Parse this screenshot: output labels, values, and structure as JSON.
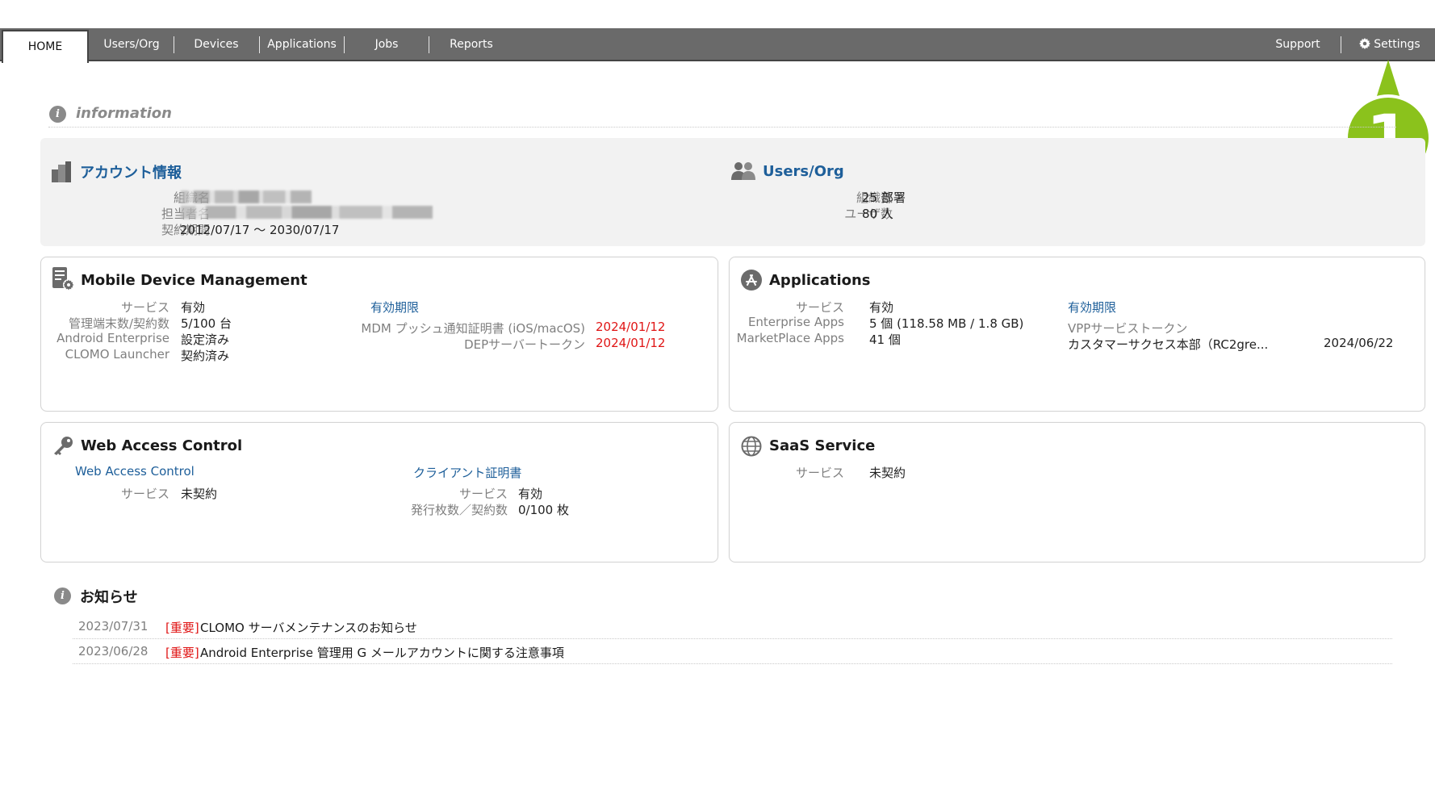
{
  "nav": {
    "tabs": [
      "HOME",
      "Users/Org",
      "Devices",
      "Applications",
      "Jobs",
      "Reports"
    ],
    "active_tab": "HOME",
    "support": "Support",
    "settings": "Settings"
  },
  "callout": {
    "number": "1",
    "color": "#8bc21c"
  },
  "info_section": {
    "title": "information"
  },
  "account": {
    "title": "アカウント情報",
    "labels": [
      "組織名",
      "担当者名",
      "契約期間"
    ],
    "contract_period": "2012/07/17 〜 2030/07/17"
  },
  "users_org": {
    "title": "Users/Org",
    "rows": [
      {
        "label": "組織数",
        "value": "25 部署"
      },
      {
        "label": "ユーザ数",
        "value": "80 人"
      }
    ]
  },
  "mdm": {
    "title": "Mobile Device Management",
    "rows": [
      {
        "label": "サービス",
        "value": "有効"
      },
      {
        "label": "管理端末数/契約数",
        "value": "5/100 台"
      },
      {
        "label": "Android Enterprise",
        "value": "設定済み"
      },
      {
        "label": "CLOMO Launcher",
        "value": "契約済み"
      }
    ],
    "expiry_title": "有効期限",
    "expiry_rows": [
      {
        "label": "MDM プッシュ通知証明書 (iOS/macOS)",
        "value": "2024/01/12"
      },
      {
        "label": "DEPサーバートークン",
        "value": "2024/01/12"
      }
    ]
  },
  "applications": {
    "title": "Applications",
    "rows": [
      {
        "label": "サービス",
        "value": "有効"
      },
      {
        "label": "Enterprise Apps",
        "value": "5 個 (118.58 MB / 1.8 GB)"
      },
      {
        "label": "MarketPlace Apps",
        "value": "41 個"
      }
    ],
    "expiry_title": "有効期限",
    "vpp_label": "VPPサービストークン",
    "vpp_name": "カスタマーサクセス本部（RC2gre...",
    "vpp_date": "2024/06/22"
  },
  "web_access": {
    "title": "Web Access Control",
    "sub_title": "Web Access Control",
    "service_label": "サービス",
    "service_value": "未契約",
    "cert_title": "クライアント証明書",
    "cert_rows": [
      {
        "label": "サービス",
        "value": "有効"
      },
      {
        "label": "発行枚数／契約数",
        "value": "0/100 枚"
      }
    ]
  },
  "saas": {
    "title": "SaaS Service",
    "service_label": "サービス",
    "service_value": "未契約"
  },
  "news": {
    "title": "お知らせ",
    "items": [
      {
        "date": "2023/07/31",
        "tag": "[重要]",
        "text": "CLOMO サーバメンテナンスのお知らせ"
      },
      {
        "date": "2023/06/28",
        "tag": "[重要]",
        "text": "Android Enterprise 管理用 G メールアカウントに関する注意事項"
      }
    ]
  },
  "colors": {
    "nav_bg": "#6a6a6a",
    "link_blue": "#1e5f9a",
    "alert_red": "#e01515",
    "callout_green": "#8bc21c"
  }
}
